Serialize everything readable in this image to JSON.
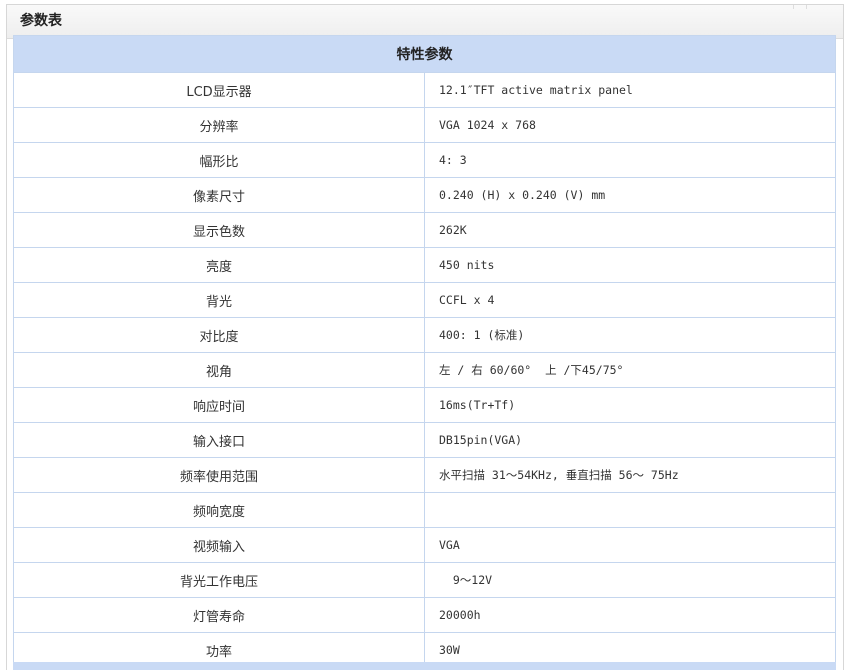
{
  "panel": {
    "title": "参数表"
  },
  "table": {
    "header": "特性参数",
    "rows": [
      {
        "key": "LCD显示器",
        "value": "12.1″TFT active matrix panel"
      },
      {
        "key": "分辨率",
        "value": "VGA 1024 x 768"
      },
      {
        "key": "幅形比",
        "value": "4: 3"
      },
      {
        "key": "像素尺寸",
        "value": "0.240 (H) x 0.240 (V) mm"
      },
      {
        "key": "显示色数",
        "value": "262K"
      },
      {
        "key": "亮度",
        "value": "450 nits"
      },
      {
        "key": "背光",
        "value": "CCFL x 4"
      },
      {
        "key": "对比度",
        "value": "400: 1 (标准)"
      },
      {
        "key": "视角",
        "value": "左 / 右 60/60°  上 /下45/75°"
      },
      {
        "key": "响应时间",
        "value": "16ms(Tr+Tf)"
      },
      {
        "key": "输入接口",
        "value": "DB15pin(VGA)"
      },
      {
        "key": "频率使用范围",
        "value": "水平扫描 31～54KHz, 垂直扫描 56～ 75Hz"
      },
      {
        "key": "频响宽度",
        "value": ""
      },
      {
        "key": "视频输入",
        "value": "VGA"
      },
      {
        "key": "背光工作电压",
        "value": "  9～12V"
      },
      {
        "key": "灯管寿命",
        "value": "20000h"
      },
      {
        "key": "功率",
        "value": "30W"
      }
    ]
  }
}
